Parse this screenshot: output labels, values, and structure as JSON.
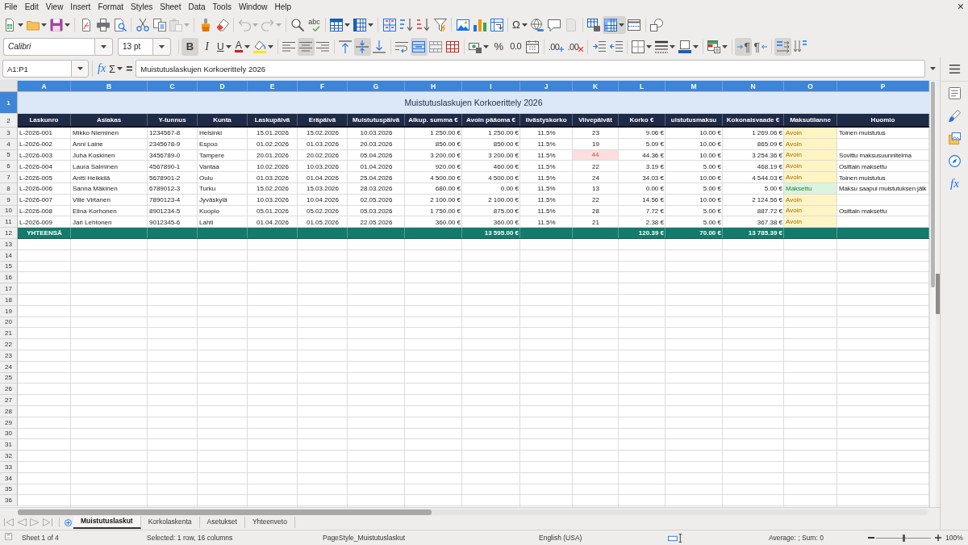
{
  "menu_bar": {
    "items": [
      "File",
      "Edit",
      "View",
      "Insert",
      "Format",
      "Styles",
      "Sheet",
      "Data",
      "Tools",
      "Window",
      "Help"
    ],
    "close_label": "×"
  },
  "standard_toolbar": {
    "paste": {
      "disabled": true
    },
    "undo": {
      "disabled": true
    },
    "redo": {
      "disabled": true
    },
    "spelling_label": "abc",
    "special_character_label": "Ω",
    "headers_footers": {
      "disabled": true
    },
    "freeze_rows_columns": {
      "active": true
    }
  },
  "formatting_toolbar": {
    "font_name": "Calibri",
    "font_size": "13 pt",
    "bold": {
      "label": "B",
      "active": true
    },
    "italic": {
      "label": "I",
      "active": false
    },
    "underline": {
      "label": "U",
      "active": false
    },
    "font_color_label": "A",
    "align_left": {
      "active": false
    },
    "align_center": {
      "active": true
    },
    "align_right": {
      "active": false
    },
    "align_top": {
      "active": false
    },
    "align_middle": {
      "active": true
    },
    "align_bottom": {
      "active": false
    },
    "wrap_text": {
      "active": false
    },
    "merge_and_center": {
      "active": true
    },
    "merge_cells": {
      "active": false
    },
    "unmerge_cells": {
      "active": false
    },
    "percent_label": "%",
    "number_label": "0.0",
    "add_decimal_label": ".00",
    "delete_decimal_label": ".00",
    "left_to_right": {
      "label": "¶",
      "active": true
    },
    "right_to_left": {
      "label": "¶",
      "active": false
    },
    "text_left_to_right": {
      "active": true
    },
    "text_top_to_bottom": {
      "active": false
    }
  },
  "formula_bar": {
    "name_box": "A1:P1",
    "function_wizard_label": "fx",
    "sum_label": "Σ",
    "formula_label": "=",
    "content": "Muistutuslaskujen Korkoerittely 2026"
  },
  "sidebar": {
    "functions_label": "fx"
  },
  "sheet": {
    "columns": [
      {
        "label": "A",
        "selected": true
      },
      {
        "label": "B",
        "selected": true
      },
      {
        "label": "C",
        "selected": true
      },
      {
        "label": "D",
        "selected": true
      },
      {
        "label": "E",
        "selected": true
      },
      {
        "label": "F",
        "selected": true
      },
      {
        "label": "G",
        "selected": true
      },
      {
        "label": "H",
        "selected": true
      },
      {
        "label": "I",
        "selected": true
      },
      {
        "label": "J",
        "selected": true
      },
      {
        "label": "K",
        "selected": true
      },
      {
        "label": "L",
        "selected": true
      },
      {
        "label": "M",
        "selected": true
      },
      {
        "label": "N",
        "selected": true
      },
      {
        "label": "O",
        "selected": true
      },
      {
        "label": "P",
        "selected": true
      }
    ],
    "rows": [
      {
        "number": "1",
        "selected": true,
        "kind": "title",
        "title": "Muistutuslaskujen Korkoerittely 2026"
      },
      {
        "number": "2",
        "selected": false,
        "kind": "header",
        "cells": [
          "Laskunro",
          "Asiakas",
          "Y-tunnus",
          "Kunta",
          "Laskupäivä",
          "Eräpäivä",
          "Muistutuspäivä",
          "Alkup. summa €",
          "Avoin pääoma €",
          "iivästyskorko",
          "Viivepäivät",
          "Korko €",
          "uistutusmaksu",
          "Kokonaisvaade €",
          "Maksutilanne",
          "Huomio"
        ]
      },
      {
        "number": "3",
        "selected": false,
        "kind": "data",
        "invoice_no": "L-2026-001",
        "customer": "Mikko Nieminen",
        "business_id": "1234567-8",
        "municipality": "Helsinki",
        "invoice_date": "15.01.2026",
        "due_date": "15.02.2026",
        "reminder_date": "10.03.2026",
        "original_amount": "1 250.00 €",
        "open_principal": "1 250.00 €",
        "interest_rate": "11.5%",
        "days_late": "23",
        "days_late_flagged": false,
        "interest": "9.06 €",
        "reminder_fee": "10.00 €",
        "total_claim": "1 269.06 €",
        "status": "Avoin",
        "paid": false,
        "note": "Toinen muistutus"
      },
      {
        "number": "4",
        "selected": false,
        "kind": "data",
        "invoice_no": "L-2026-002",
        "customer": "Anni Laine",
        "business_id": "2345678-9",
        "municipality": "Espoo",
        "invoice_date": "01.02.2026",
        "due_date": "01.03.2026",
        "reminder_date": "20.03.2026",
        "original_amount": "850.00 €",
        "open_principal": "850.00 €",
        "interest_rate": "11.5%",
        "days_late": "19",
        "days_late_flagged": false,
        "interest": "5.09 €",
        "reminder_fee": "10.00 €",
        "total_claim": "865.09 €",
        "status": "Avoin",
        "paid": false
      },
      {
        "number": "5",
        "selected": false,
        "kind": "data",
        "invoice_no": "L-2026-003",
        "customer": "Juha Koskinen",
        "business_id": "3456789-0",
        "municipality": "Tampere",
        "invoice_date": "20.01.2026",
        "due_date": "20.02.2026",
        "reminder_date": "05.04.2026",
        "original_amount": "3 200.00 €",
        "open_principal": "3 200.00 €",
        "interest_rate": "11.5%",
        "days_late": "44",
        "days_late_flagged": true,
        "interest": "44.36 €",
        "reminder_fee": "10.00 €",
        "total_claim": "3 254.36 €",
        "status": "Avoin",
        "paid": false,
        "note": "Sovittu maksusuunnitelma"
      },
      {
        "number": "6",
        "selected": false,
        "kind": "data",
        "invoice_no": "L-2026-004",
        "customer": "Laura Salminen",
        "business_id": "4567890-1",
        "municipality": "Vantaa",
        "invoice_date": "10.02.2026",
        "due_date": "10.03.2026",
        "reminder_date": "01.04.2026",
        "original_amount": "920.00 €",
        "open_principal": "460.00 €",
        "interest_rate": "11.5%",
        "days_late": "22",
        "days_late_flagged": false,
        "interest": "3.19 €",
        "reminder_fee": "5.00 €",
        "total_claim": "468.19 €",
        "status": "Avoin",
        "paid": false,
        "note": "Osittain maksettu"
      },
      {
        "number": "7",
        "selected": false,
        "kind": "data",
        "invoice_no": "L-2026-005",
        "customer": "Antti Heikkilä",
        "business_id": "5678901-2",
        "municipality": "Oulu",
        "invoice_date": "01.03.2026",
        "due_date": "01.04.2026",
        "reminder_date": "25.04.2026",
        "original_amount": "4 500.00 €",
        "open_principal": "4 500.00 €",
        "interest_rate": "11.5%",
        "days_late": "24",
        "days_late_flagged": false,
        "interest": "34.03 €",
        "reminder_fee": "10.00 €",
        "total_claim": "4 544.03 €",
        "status": "Avoin",
        "paid": false,
        "note": "Toinen muistutus"
      },
      {
        "number": "8",
        "selected": false,
        "kind": "data",
        "invoice_no": "L-2026-006",
        "customer": "Sanna Mäkinen",
        "business_id": "6789012-3",
        "municipality": "Turku",
        "invoice_date": "15.02.2026",
        "due_date": "15.03.2026",
        "reminder_date": "28.03.2026",
        "original_amount": "680.00 €",
        "open_principal": "0.00 €",
        "interest_rate": "11.5%",
        "days_late": "13",
        "days_late_flagged": false,
        "interest": "0.00 €",
        "reminder_fee": "5.00 €",
        "total_claim": "5.00 €",
        "status": "Maksettu",
        "paid": true,
        "note": "Maksu saapui muistutuksen jälk"
      },
      {
        "number": "9",
        "selected": false,
        "kind": "data",
        "invoice_no": "L-2026-007",
        "customer": "Ville Virtanen",
        "business_id": "7890123-4",
        "municipality": "Jyväskylä",
        "invoice_date": "10.03.2026",
        "due_date": "10.04.2026",
        "reminder_date": "02.05.2026",
        "original_amount": "2 100.00 €",
        "open_principal": "2 100.00 €",
        "interest_rate": "11.5%",
        "days_late": "22",
        "days_late_flagged": false,
        "interest": "14.56 €",
        "reminder_fee": "10.00 €",
        "total_claim": "2 124.56 €",
        "status": "Avoin",
        "paid": false
      },
      {
        "number": "10",
        "selected": false,
        "kind": "data",
        "invoice_no": "L-2026-008",
        "customer": "Elina Korhonen",
        "business_id": "8901234-5",
        "municipality": "Kuopio",
        "invoice_date": "05.01.2026",
        "due_date": "05.02.2026",
        "reminder_date": "05.03.2026",
        "original_amount": "1 750.00 €",
        "open_principal": "875.00 €",
        "interest_rate": "11.5%",
        "days_late": "28",
        "days_late_flagged": false,
        "interest": "7.72 €",
        "reminder_fee": "5.00 €",
        "total_claim": "887.72 €",
        "status": "Avoin",
        "paid": false,
        "note": "Osittain maksettu"
      },
      {
        "number": "11",
        "selected": false,
        "kind": "data",
        "invoice_no": "L-2026-009",
        "customer": "Jari Lehtonen",
        "business_id": "9012345-6",
        "municipality": "Lahti",
        "invoice_date": "01.04.2026",
        "due_date": "01.05.2026",
        "reminder_date": "22.05.2026",
        "original_amount": "360.00 €",
        "open_principal": "360.00 €",
        "interest_rate": "11.5%",
        "days_late": "21",
        "days_late_flagged": false,
        "interest": "2.38 €",
        "reminder_fee": "5.00 €",
        "total_claim": "367.38 €",
        "status": "Avoin",
        "paid": false
      },
      {
        "number": "12",
        "selected": false,
        "kind": "total",
        "label": "YHTEENSÄ",
        "open_principal": "13 595.00 €",
        "interest": "120.39 €",
        "reminder_fee": "70.00 €",
        "total_claim": "13 785.39 €"
      },
      {
        "number": "13",
        "selected": false,
        "kind": "empty"
      },
      {
        "number": "14",
        "selected": false,
        "kind": "empty"
      },
      {
        "number": "15",
        "selected": false,
        "kind": "empty"
      },
      {
        "number": "16",
        "selected": false,
        "kind": "empty"
      },
      {
        "number": "17",
        "selected": false,
        "kind": "empty"
      },
      {
        "number": "18",
        "selected": false,
        "kind": "empty"
      },
      {
        "number": "19",
        "selected": false,
        "kind": "empty"
      },
      {
        "number": "20",
        "selected": false,
        "kind": "empty"
      },
      {
        "number": "21",
        "selected": false,
        "kind": "empty"
      },
      {
        "number": "22",
        "selected": false,
        "kind": "empty"
      },
      {
        "number": "23",
        "selected": false,
        "kind": "empty"
      },
      {
        "number": "24",
        "selected": false,
        "kind": "empty"
      },
      {
        "number": "25",
        "selected": false,
        "kind": "empty"
      },
      {
        "number": "26",
        "selected": false,
        "kind": "empty"
      },
      {
        "number": "27",
        "selected": false,
        "kind": "empty"
      },
      {
        "number": "28",
        "selected": false,
        "kind": "empty"
      },
      {
        "number": "29",
        "selected": false,
        "kind": "empty"
      },
      {
        "number": "30",
        "selected": false,
        "kind": "empty"
      },
      {
        "number": "31",
        "selected": false,
        "kind": "empty"
      },
      {
        "number": "32",
        "selected": false,
        "kind": "empty"
      },
      {
        "number": "33",
        "selected": false,
        "kind": "empty"
      },
      {
        "number": "34",
        "selected": false,
        "kind": "empty"
      },
      {
        "number": "35",
        "selected": false,
        "kind": "empty"
      },
      {
        "number": "36",
        "selected": false,
        "kind": "empty"
      }
    ]
  },
  "sheet_navigation": {
    "disabled": true
  },
  "sheet_tabs": [
    {
      "label": "Muistutuslaskut",
      "selected": true
    },
    {
      "label": "Korkolaskenta",
      "selected": false
    },
    {
      "label": "Asetukset",
      "selected": false
    },
    {
      "label": "Yhteenveto",
      "selected": false
    }
  ],
  "status_bar": {
    "sheet_position": "Sheet 1 of 4",
    "selection": "Selected: 1 row, 16 columns",
    "page_style": "PageStyle_Muistutuslaskut",
    "language": "English (USA)",
    "statistics": "Average: ; Sum: 0",
    "zoom_slider": {
      "level": 0.5
    },
    "zoom": "100%"
  }
}
